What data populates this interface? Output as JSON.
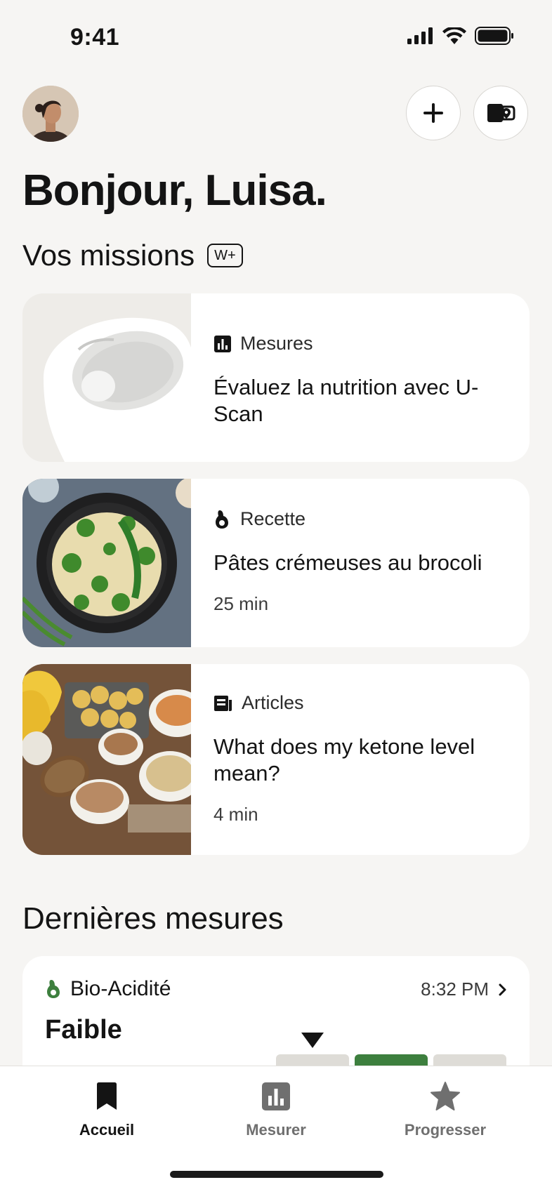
{
  "status": {
    "time": "9:41"
  },
  "header": {
    "greeting": "Bonjour, Luisa."
  },
  "missions": {
    "title": "Vos missions",
    "badge": "W+",
    "cards": [
      {
        "category": "Mesures",
        "category_icon": "bar-chart-icon",
        "title": "Évaluez la nutrition avec U-Scan",
        "meta": ""
      },
      {
        "category": "Recette",
        "category_icon": "avocado-icon",
        "title": "Pâtes crémeuses au brocoli",
        "meta": "25 min"
      },
      {
        "category": "Articles",
        "category_icon": "article-icon",
        "title": "What does my ketone level mean?",
        "meta": "4 min"
      }
    ]
  },
  "latest": {
    "title": "Dernières mesures",
    "card": {
      "name": "Bio-Acidité",
      "time": "8:32 PM",
      "level": "Faible",
      "accent": "#3d7f3e"
    }
  },
  "tabs": [
    {
      "label": "Accueil",
      "icon": "bookmark-icon",
      "active": true
    },
    {
      "label": "Mesurer",
      "icon": "bar-chart-icon",
      "active": false
    },
    {
      "label": "Progresser",
      "icon": "star-icon",
      "active": false
    }
  ],
  "colors": {
    "background": "#f6f5f3",
    "accent_green": "#3d7f3e",
    "inactive": "#6f6f6f"
  }
}
